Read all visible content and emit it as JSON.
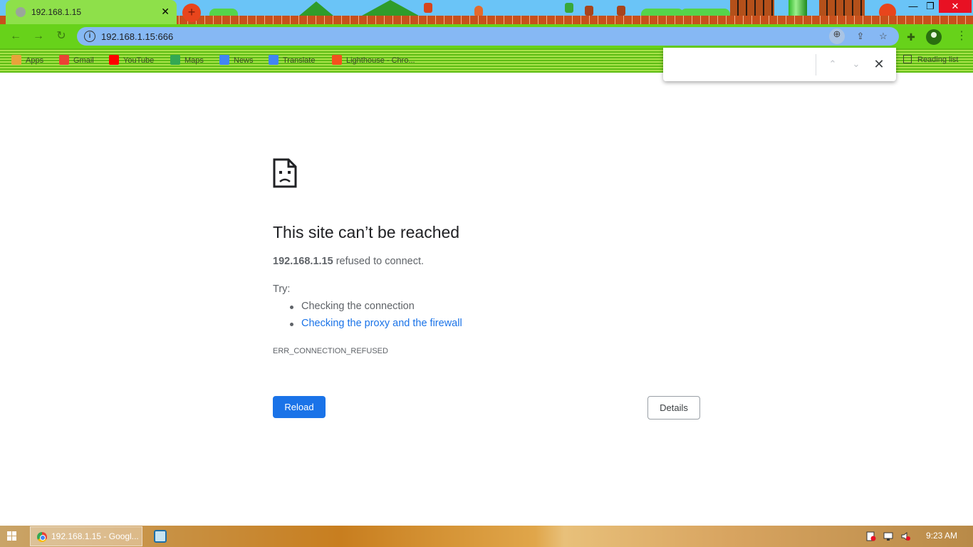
{
  "tab": {
    "title": "192.168.1.15",
    "close": "✕",
    "new_tab": "+"
  },
  "window_controls": {
    "minimize": "—",
    "restore": "❐",
    "close": "✕"
  },
  "toolbar": {
    "back": "←",
    "forward": "→",
    "reload": "↻",
    "url": "192.168.1.15:666",
    "icons": [
      "zoom-icon",
      "share-icon",
      "star-icon",
      "extensions-icon",
      "profile-icon",
      "menu-icon"
    ]
  },
  "bookmarks": [
    {
      "label": "Apps",
      "color": "#e8a33b"
    },
    {
      "label": "Gmail",
      "color": "#ea4335"
    },
    {
      "label": "YouTube",
      "color": "#ff0000"
    },
    {
      "label": "Maps",
      "color": "#34a853"
    },
    {
      "label": "News",
      "color": "#4285f4"
    },
    {
      "label": "Translate",
      "color": "#4285f4"
    },
    {
      "label": "Lighthouse - Chro...",
      "color": "#f4511e"
    }
  ],
  "reading_list": "Reading list",
  "find_bar": {
    "value": "",
    "up": "⌃",
    "down": "⌄",
    "close": "✕"
  },
  "error_page": {
    "title": "This site can’t be reached",
    "host": "192.168.1.15",
    "message": " refused to connect.",
    "try_label": "Try:",
    "suggestions": [
      "Checking the connection",
      "Checking the proxy and the firewall"
    ],
    "error_code": "ERR_CONNECTION_REFUSED",
    "reload_label": "Reload",
    "details_label": "Details"
  },
  "taskbar": {
    "active_window": "192.168.1.15 - Googl...",
    "clock": "9:23 AM"
  },
  "colors": {
    "accent": "#1a73e8",
    "text": "#202124",
    "secondary_text": "#5f6368"
  }
}
